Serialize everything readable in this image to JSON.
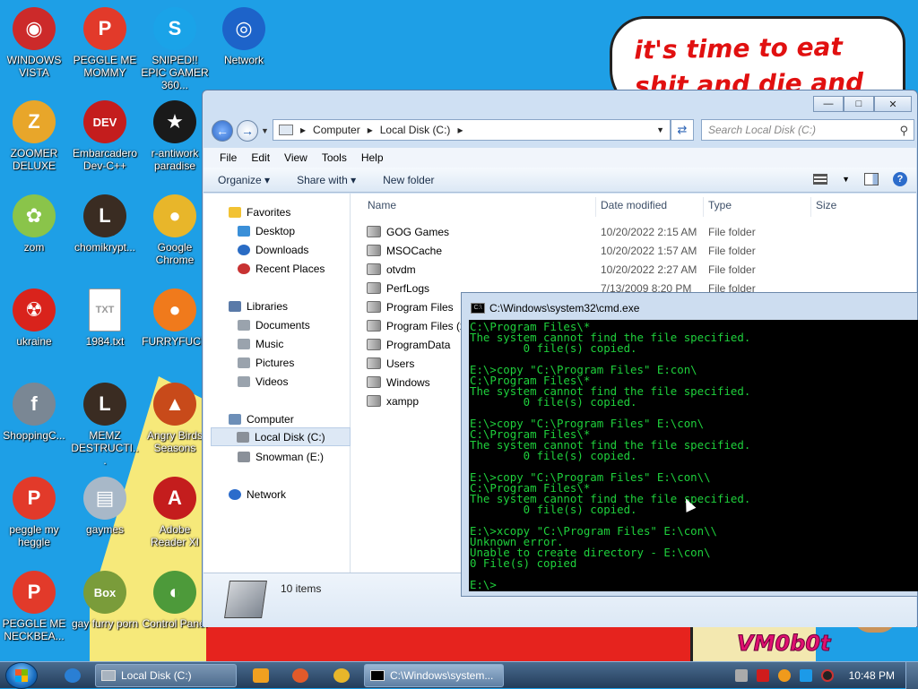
{
  "wallpaper": {
    "bubble_text": "it's time to eat shit and die and chew",
    "signature": "VM0b0t"
  },
  "desktop_icons": [
    {
      "label": "WINDOWS VISTA",
      "color": "#cc2a2a",
      "glyph": "◉"
    },
    {
      "label": "PEGGLE ME MOMMY",
      "color": "#e23a2a",
      "glyph": "P"
    },
    {
      "label": "SNIPED!! EPIC GAMER 360...",
      "color": "#1aa3e8",
      "glyph": "S"
    },
    {
      "label": "Network",
      "color": "#1d63c9",
      "glyph": "◎"
    },
    {
      "label": "ZOOMER DELUXE",
      "color": "#e8a62a",
      "glyph": "Z"
    },
    {
      "label": "Embarcadero Dev-C++",
      "color": "#c41d1d",
      "glyph": "DEV"
    },
    {
      "label": "r-antiwork paradise",
      "color": "#1a1a1a",
      "glyph": "★"
    },
    {
      "label": "zom",
      "color": "#8ac44a",
      "glyph": "✿"
    },
    {
      "label": "chomikrypt...",
      "color": "#3a2c22",
      "glyph": "L"
    },
    {
      "label": "Google Chrome",
      "color": "#e8b62a",
      "glyph": "●"
    },
    {
      "label": "ukraine",
      "color": "#d9231c",
      "glyph": "☢"
    },
    {
      "label": "1984.txt",
      "color": "#ffffff",
      "glyph": "TXT"
    },
    {
      "label": "FURRYFUCK",
      "color": "#f07a1c",
      "glyph": "●"
    },
    {
      "label": "ShoppingC...",
      "color": "#7a8794",
      "glyph": "f"
    },
    {
      "label": "MEMZ DESTRUCTI...",
      "color": "#3a2c22",
      "glyph": "L"
    },
    {
      "label": "Angry Birds Seasons",
      "color": "#c84a1a",
      "glyph": "▲"
    },
    {
      "label": "peggle my heggle",
      "color": "#e23a2a",
      "glyph": "P"
    },
    {
      "label": "gaymes",
      "color": "#a8b8c8",
      "glyph": "▤"
    },
    {
      "label": "Adobe Reader XI",
      "color": "#c41d1d",
      "glyph": "A"
    },
    {
      "label": "PEGGLE ME NECKBEA...",
      "color": "#e23a2a",
      "glyph": "P"
    },
    {
      "label": "gay furry porn",
      "color": "#7a9c3a",
      "glyph": "Box"
    },
    {
      "label": "Control Panel",
      "color": "#4d9a3a",
      "glyph": "◐"
    }
  ],
  "explorer": {
    "breadcrumb": [
      "Computer",
      "Local Disk (C:)"
    ],
    "search_placeholder": "Search Local Disk (C:)",
    "menu": [
      "File",
      "Edit",
      "View",
      "Tools",
      "Help"
    ],
    "commands": {
      "organize": "Organize",
      "share": "Share with",
      "new_folder": "New folder"
    },
    "nav": {
      "favorites": "Favorites",
      "desktop": "Desktop",
      "downloads": "Downloads",
      "recent": "Recent Places",
      "libraries": "Libraries",
      "documents": "Documents",
      "music": "Music",
      "pictures": "Pictures",
      "videos": "Videos",
      "computer": "Computer",
      "local_disk": "Local Disk (C:)",
      "snowman": "Snowman (E:)",
      "network": "Network"
    },
    "columns": {
      "name": "Name",
      "date": "Date modified",
      "type": "Type",
      "size": "Size"
    },
    "files": [
      {
        "name": "GOG Games",
        "date": "10/20/2022 2:15 AM",
        "type": "File folder"
      },
      {
        "name": "MSOCache",
        "date": "10/20/2022 1:57 AM",
        "type": "File folder"
      },
      {
        "name": "otvdm",
        "date": "10/20/2022 2:27 AM",
        "type": "File folder"
      },
      {
        "name": "PerfLogs",
        "date": "7/13/2009 8:20 PM",
        "type": "File folder"
      },
      {
        "name": "Program Files",
        "date": "",
        "type": ""
      },
      {
        "name": "Program Files (x",
        "date": "",
        "type": ""
      },
      {
        "name": "ProgramData",
        "date": "",
        "type": ""
      },
      {
        "name": "Users",
        "date": "",
        "type": ""
      },
      {
        "name": "Windows",
        "date": "",
        "type": ""
      },
      {
        "name": "xampp",
        "date": "",
        "type": ""
      }
    ],
    "items_count": "10 items"
  },
  "cmd": {
    "title": "C:\\Windows\\system32\\cmd.exe",
    "lines": [
      "C:\\Program Files\\*",
      "The system cannot find the file specified.",
      "        0 file(s) copied.",
      "",
      "E:\\>copy \"C:\\Program Files\" E:con\\",
      "C:\\Program Files\\*",
      "The system cannot find the file specified.",
      "        0 file(s) copied.",
      "",
      "E:\\>copy \"C:\\Program Files\" E:\\con\\",
      "C:\\Program Files\\*",
      "The system cannot find the file specified.",
      "        0 file(s) copied.",
      "",
      "E:\\>copy \"C:\\Program Files\" E:\\con\\\\",
      "C:\\Program Files\\*",
      "The system cannot find the file specified.",
      "        0 file(s) copied.",
      "",
      "E:\\>xcopy \"C:\\Program Files\" E:\\con\\\\",
      "Unknown error.",
      "Unable to create directory - E:\\con\\",
      "0 File(s) copied",
      "",
      "E:\\>"
    ]
  },
  "taskbar": {
    "tasks": [
      {
        "label": "Local Disk (C:)",
        "active": false
      },
      {
        "label": "C:\\Windows\\system...",
        "active": true
      }
    ],
    "clock": "10:48 PM"
  }
}
